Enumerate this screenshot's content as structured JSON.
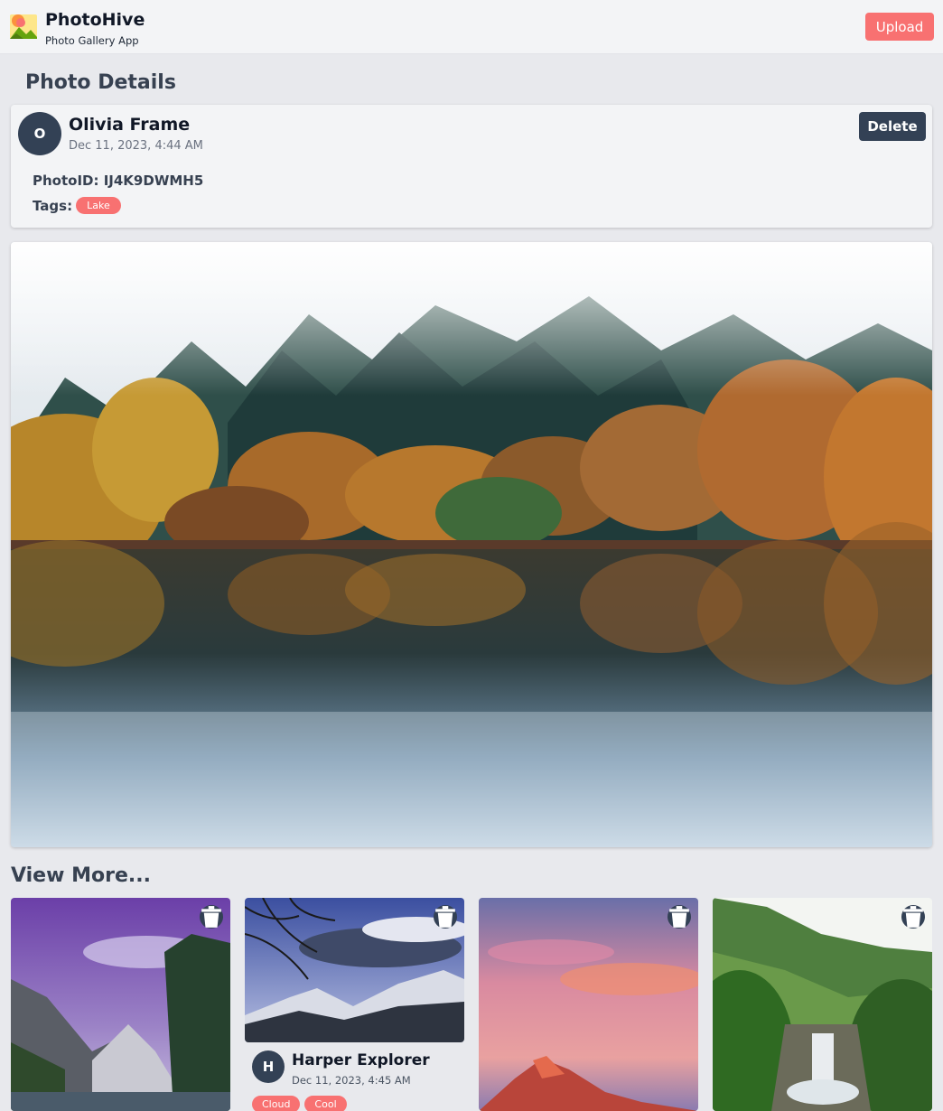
{
  "header": {
    "app_name": "PhotoHive",
    "subtitle": "Photo Gallery App",
    "upload_label": "Upload"
  },
  "page": {
    "title": "Photo Details",
    "view_more_title": "View More..."
  },
  "photo": {
    "author_initial": "O",
    "author_name": "Olivia Frame",
    "date": "Dec 11, 2023, 4:44 AM",
    "delete_label": "Delete",
    "photo_id_text": "PhotoID: IJ4K9DWMH5",
    "tags_label": "Tags:",
    "tags": [
      "Lake"
    ]
  },
  "more": {
    "cards": [
      {
        "scene": "alpine-lake-purple-sky"
      },
      {
        "scene": "snowy-mountains-branches",
        "author_initial": "H",
        "author_name": "Harper Explorer",
        "date": "Dec 11, 2023, 4:45 AM",
        "tags": [
          "Cloud",
          "Cool"
        ]
      },
      {
        "scene": "pink-sky-red-peak"
      },
      {
        "scene": "green-waterfall-valley"
      }
    ]
  },
  "colors": {
    "accent": "#f87171",
    "dark": "#334155",
    "background": "#e8e9ed",
    "card": "#f3f4f6"
  },
  "icons": {
    "logo": "photo-landscape-icon",
    "delete": "trash-icon"
  }
}
